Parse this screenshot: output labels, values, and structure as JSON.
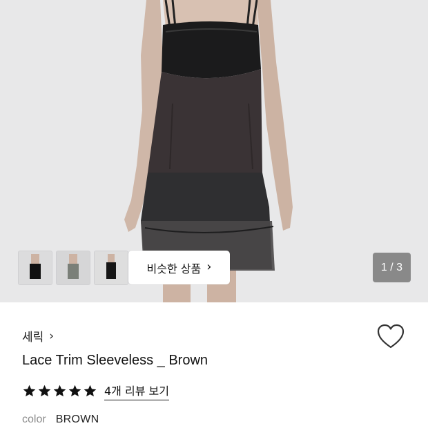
{
  "hero": {
    "similar_label": "비슷한 상품",
    "page_indicator": "1 / 3",
    "thumbnails": [
      "thumbnail-black-top",
      "thumbnail-grey-top",
      "thumbnail-black-top-2"
    ]
  },
  "product": {
    "brand": "세릭",
    "title": "Lace Trim Sleeveless _ Brown",
    "rating": 5,
    "reviews_label": "4개 리뷰 보기",
    "color_label": "color",
    "color_value": "BROWN"
  },
  "icons": {
    "wishlist": "heart-outline-icon",
    "star": "star-filled-icon",
    "chevron": "chevron-right-icon"
  },
  "colors": {
    "background": "#ffffff",
    "hero_bg": "#e9e9ea",
    "text": "#111111",
    "muted": "#8a8a8a",
    "page_indicator_bg": "#787878"
  }
}
